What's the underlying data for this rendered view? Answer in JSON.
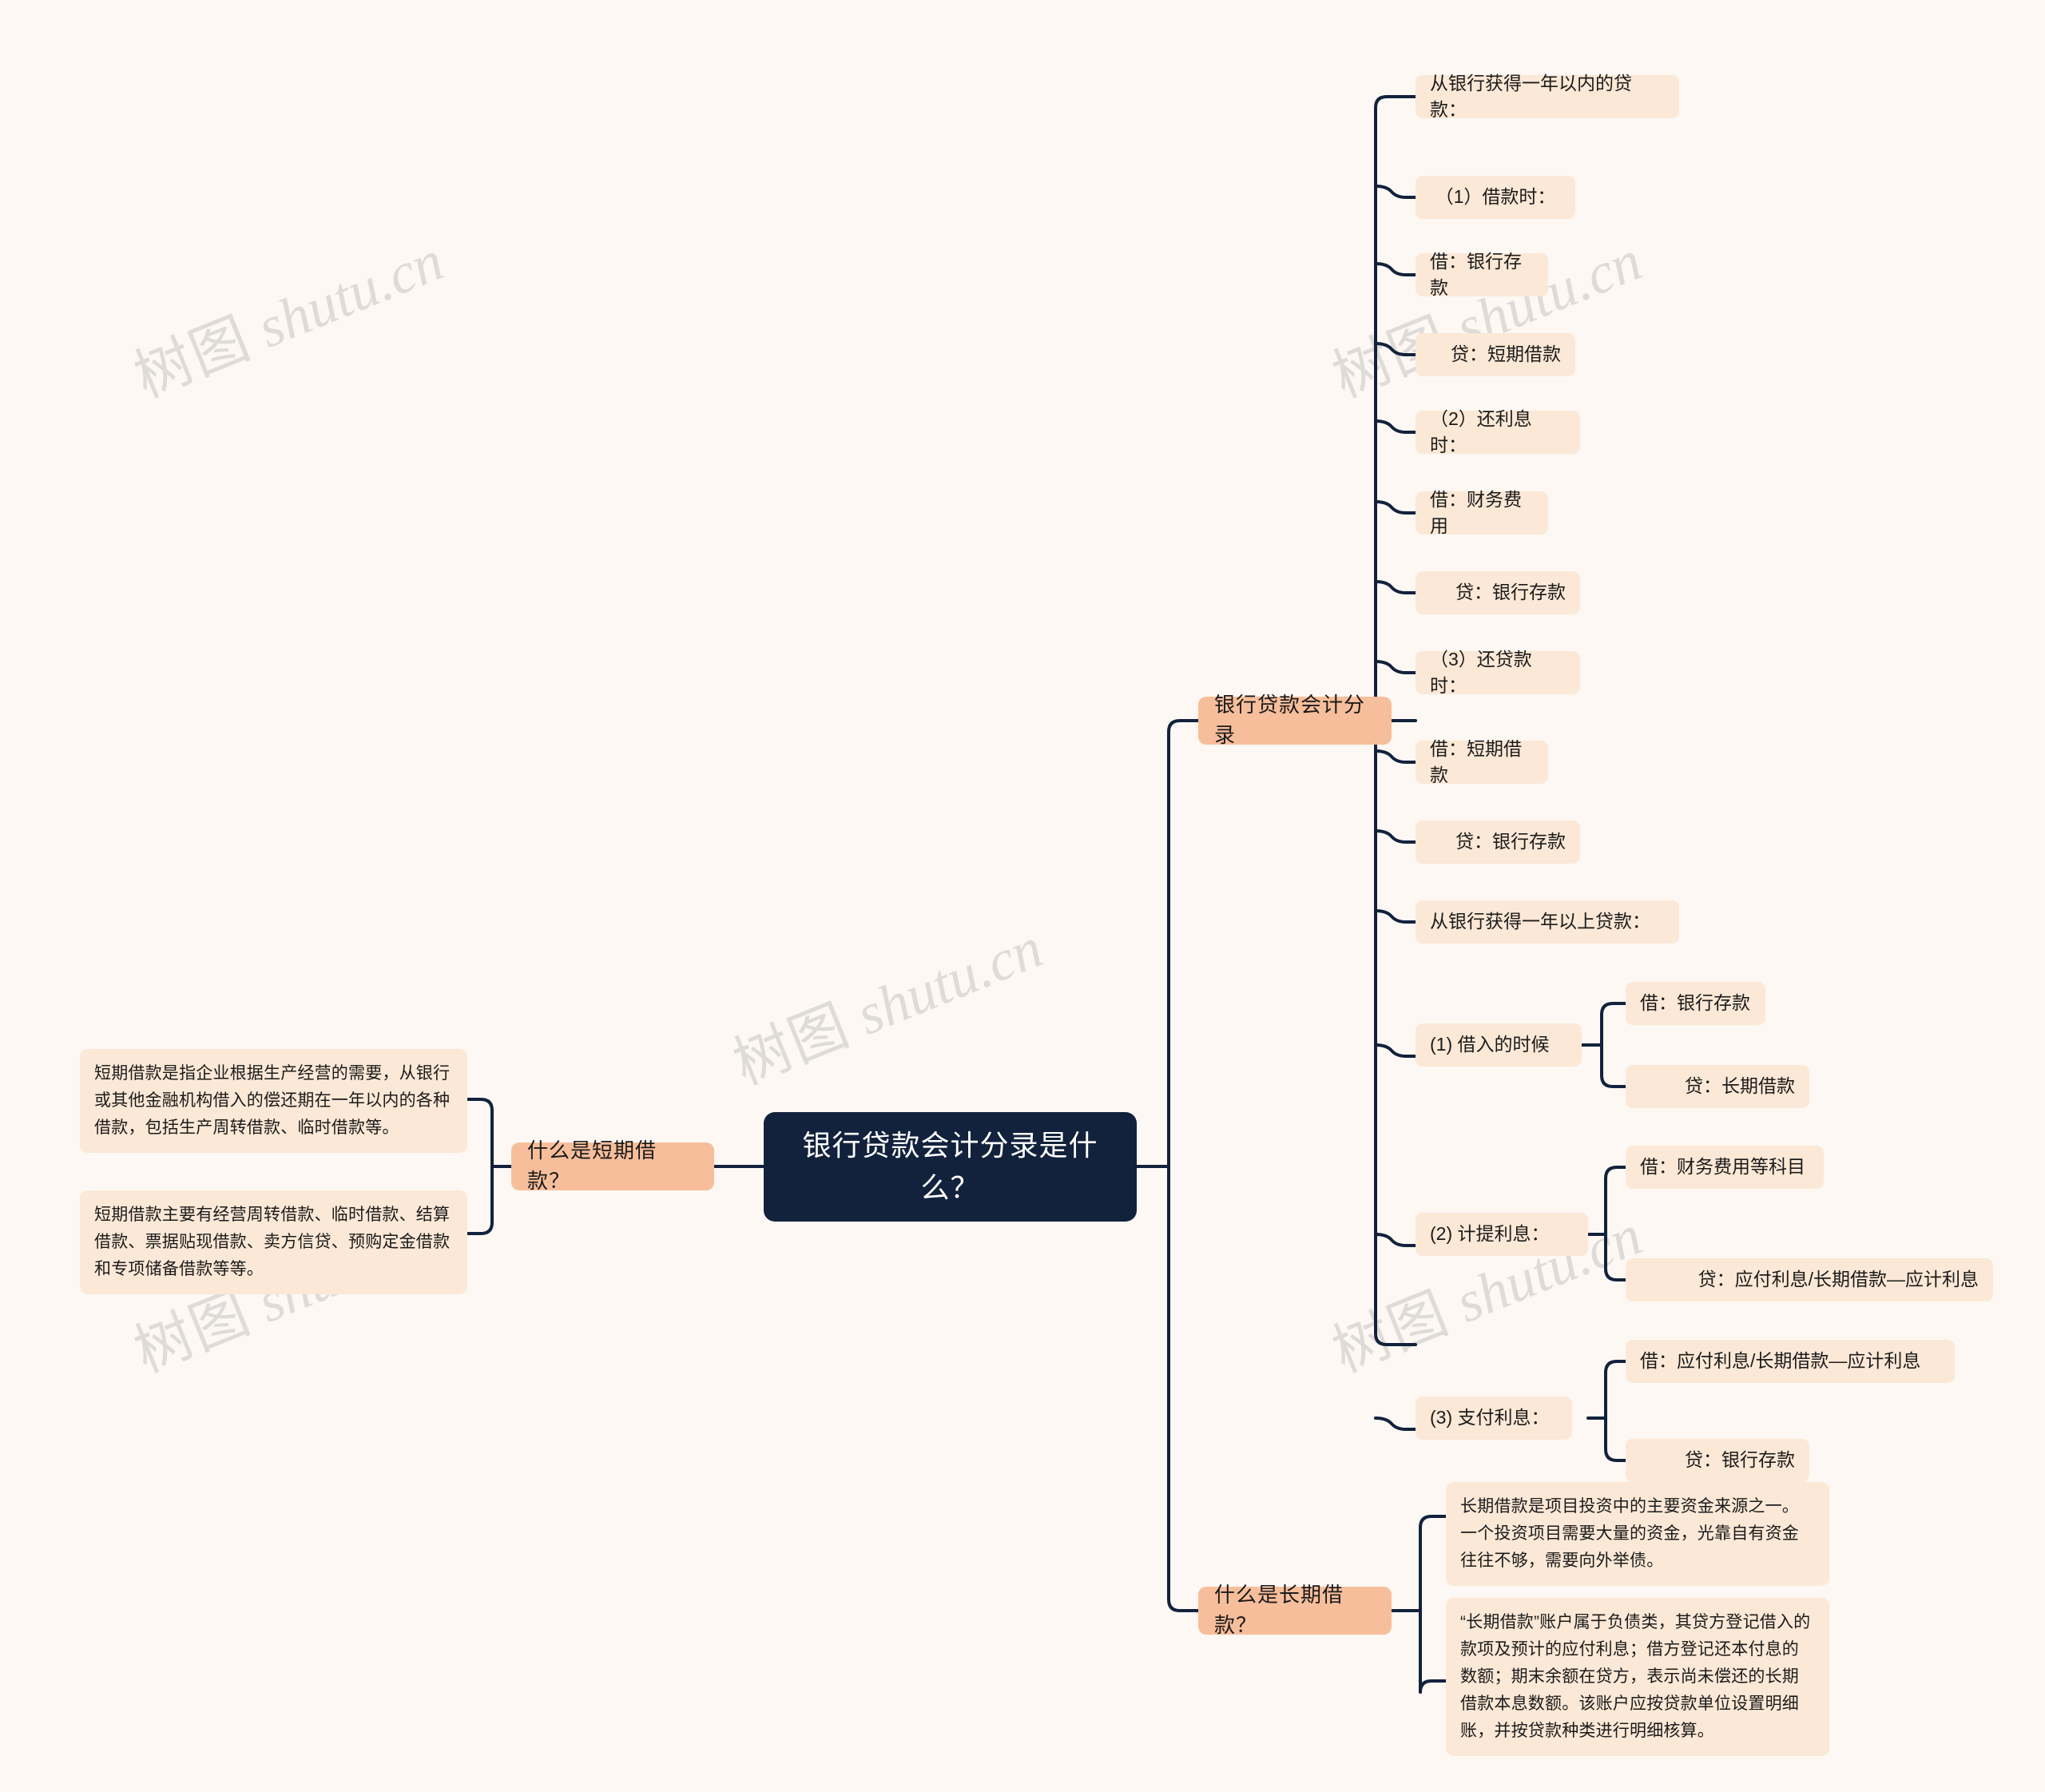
{
  "colors": {
    "background": "#FDF8F3",
    "root_fill": "#12223C",
    "root_text": "#FFFFFF",
    "level1_fill": "#F7BE9B",
    "leaf_fill": "#FBE8D6",
    "link_stroke": "#12223C",
    "watermark": "#DEDBD8"
  },
  "watermark": {
    "cjk": "树图",
    "latin": "shutu.cn"
  },
  "mindmap": {
    "root": {
      "label": "银行贷款会计分录是什么？"
    },
    "branches": [
      {
        "id": "bank-loan-entries",
        "label": "银行贷款会计分录",
        "children": [
          {
            "label": "从银行获得一年以内的贷款："
          },
          {
            "label": "（1）借款时："
          },
          {
            "label": "借：银行存款"
          },
          {
            "label": "贷：短期借款"
          },
          {
            "label": "（2）还利息时："
          },
          {
            "label": "借：财务费用"
          },
          {
            "label": "贷：银行存款"
          },
          {
            "label": "（3）还贷款时："
          },
          {
            "label": "借：短期借款"
          },
          {
            "label": "贷：银行存款"
          },
          {
            "label": "从银行获得一年以上贷款："
          },
          {
            "label": "(1) 借入的时候",
            "children": [
              {
                "label": "借：银行存款"
              },
              {
                "label": "贷：长期借款"
              }
            ]
          },
          {
            "label": "(2) 计提利息：",
            "children": [
              {
                "label": "借：财务费用等科目"
              },
              {
                "label": "贷：应付利息/长期借款—应计利息"
              }
            ]
          },
          {
            "label": "(3) 支付利息：",
            "children": [
              {
                "label": "借：应付利息/长期借款—应计利息"
              },
              {
                "label": "贷：银行存款"
              }
            ]
          }
        ]
      },
      {
        "id": "what-is-short-term-loan",
        "label": "什么是短期借款？",
        "children": [
          {
            "label": "短期借款是指企业根据生产经营的需要，从银行或其他金融机构借入的偿还期在一年以内的各种借款，包括生产周转借款、临时借款等。"
          },
          {
            "label": "短期借款主要有经营周转借款、临时借款、结算借款、票据贴现借款、卖方信贷、预购定金借款和专项储备借款等等。"
          }
        ]
      },
      {
        "id": "what-is-long-term-loan",
        "label": "什么是长期借款？",
        "children": [
          {
            "label": "长期借款是项目投资中的主要资金来源之一。一个投资项目需要大量的资金，光靠自有资金往往不够，需要向外举债。"
          },
          {
            "label": "“长期借款”账户属于负债类，其贷方登记借入的款项及预计的应付利息；借方登记还本付息的数额；期末余额在贷方，表示尚未偿还的长期借款本息数额。该账户应按贷款单位设置明细账，并按贷款种类进行明细核算。"
          }
        ]
      }
    ]
  }
}
